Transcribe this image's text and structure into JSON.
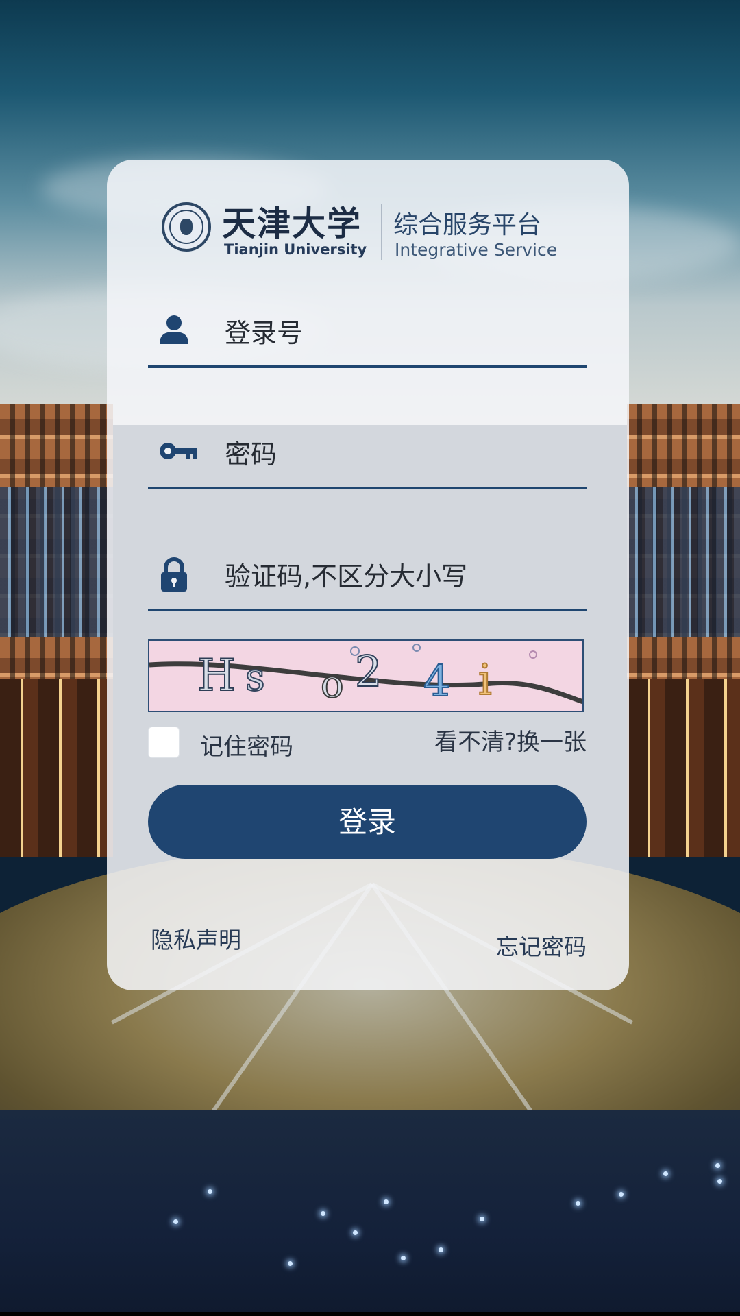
{
  "logo": {
    "university_cn": "天津大学",
    "university_en": "Tianjin University",
    "platform_cn": "综合服务平台",
    "platform_en": "Integrative Service"
  },
  "form": {
    "username": {
      "icon": "user-icon",
      "placeholder": "登录号",
      "value": ""
    },
    "password": {
      "icon": "key-icon",
      "placeholder": "密码",
      "value": ""
    },
    "captcha": {
      "icon": "lock-icon",
      "placeholder": "验证码,不区分大小写",
      "value": "",
      "image_text": "Hs o2 4i"
    }
  },
  "remember": {
    "label": "记住密码",
    "checked": false
  },
  "refresh_captcha_label": "看不清?换一张",
  "login_button": "登录",
  "footer": {
    "privacy": "隐私声明",
    "forgot": "忘记密码"
  },
  "colors": {
    "primary": "#1f4571",
    "card": "#f4f6f9",
    "captcha_bg": "#f3d6e3"
  }
}
